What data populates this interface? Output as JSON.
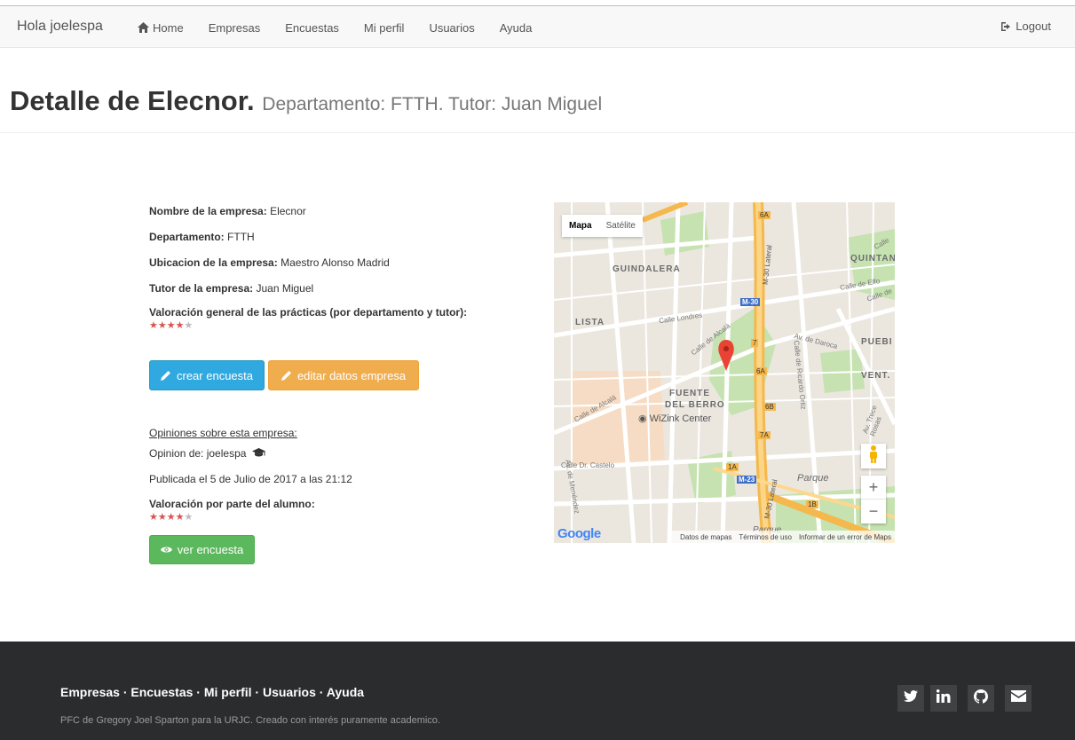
{
  "navbar": {
    "brand": "Hola joelespa",
    "items": [
      {
        "label": "Home"
      },
      {
        "label": "Empresas"
      },
      {
        "label": "Encuestas"
      },
      {
        "label": "Mi perfil"
      },
      {
        "label": "Usuarios"
      },
      {
        "label": "Ayuda"
      }
    ],
    "logout": "Logout"
  },
  "header": {
    "title": "Detalle de Elecnor.",
    "subtitle": "Departamento: FTTH. Tutor: Juan Miguel"
  },
  "company": {
    "name_label": "Nombre de la empresa:",
    "name_value": "Elecnor",
    "dept_label": "Departamento:",
    "dept_value": "FTTH",
    "location_label": "Ubicacion de la empresa:",
    "location_value": "Maestro Alonso Madrid",
    "tutor_label": "Tutor de la empresa:",
    "tutor_value": "Juan Miguel",
    "rating_label": "Valoración general de las prácticas (por departamento y tutor):",
    "rating": 4,
    "rating_max": 5
  },
  "actions": {
    "create_survey": "crear encuesta",
    "edit_company": "editar datos empresa"
  },
  "opinions": {
    "heading": "Opiniones sobre esta empresa:",
    "author": "Opinion de: joelespa",
    "published": "Publicada el 5 de Julio de 2017 a las 21:12",
    "rating_label": "Valoración por parte del alumno:",
    "rating": 4,
    "rating_max": 5,
    "view_survey": "ver encuesta"
  },
  "map": {
    "type_map": "Mapa",
    "type_satellite": "Satélite",
    "zoom_in": "+",
    "zoom_out": "−",
    "logo": "Google",
    "footer_data": "Datos de mapas",
    "footer_terms": "Términos de uso",
    "footer_report": "Informar de un error de Maps",
    "labels": {
      "guindalera": "GUINDALERA",
      "lista": "LISTA",
      "quintana": "QUINTAN",
      "pueblo": "PUEBI",
      "ventas": "VENT.",
      "fuente": "FUENTE",
      "del_berro": "DEL BERRO",
      "wizink": "WiZink Center",
      "parque": "Parque",
      "parque2": "Parque",
      "m30": "M-30",
      "m23": "M-23",
      "m30_lateral": "M-30 Lateral",
      "m30_lateral2": "M-30 Lateral",
      "calle_londres": "Calle Londres",
      "calle_alcala": "Calle de Alcalá",
      "calle_alcala2": "Calle de Alcalá",
      "av_daroca": "Av. de Daroca",
      "calle_elfo": "Calle de Elfo",
      "calle_castelo": "Calle Dr. Castelo",
      "av_menendez": "Av. de Menéndez",
      "calle_ricardo": "Calle de Ricardo Ortiz",
      "trece_rosas": "Av. Trece Rosas",
      "calle_top": "Calle",
      "calle_right": "Calle de",
      "r_6a": "6A",
      "r_6a2": "6A",
      "r_6b": "6B",
      "r_7": "7",
      "r_7a": "7A",
      "r_1a": "1A",
      "r_1b": "1B"
    }
  },
  "footer": {
    "links": "Empresas · Encuestas · Mi perfil · Usuarios · Ayuda",
    "text": "PFC de Gregory Joel Sparton para la URJC. Creado con interés puramente academico.",
    "colors": {
      "bg": "#2b2c2e"
    }
  }
}
